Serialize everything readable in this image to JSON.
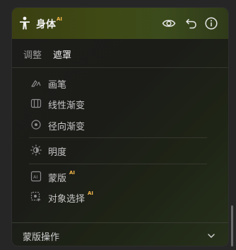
{
  "header": {
    "title": "身体",
    "title_badge": "AI",
    "icons": [
      "person-icon",
      "eye-icon",
      "undo-icon",
      "info-icon"
    ]
  },
  "tabs": [
    {
      "label": "调整",
      "active": false
    },
    {
      "label": "遮罩",
      "active": true
    }
  ],
  "items": [
    {
      "label": "画笔",
      "icon": "brush-icon"
    },
    {
      "label": "线性渐变",
      "icon": "linear-gradient-icon"
    },
    {
      "label": "径向渐变",
      "icon": "radial-gradient-icon"
    },
    {
      "label": "明度",
      "icon": "brightness-icon"
    },
    {
      "label": "蒙版",
      "badge": "AI",
      "icon": "ai-mask-icon"
    },
    {
      "label": "对象选择",
      "badge": "AI",
      "icon": "object-select-icon"
    }
  ],
  "footer": {
    "label": "蒙版操作",
    "icon": "chevron-down-icon"
  },
  "colors": {
    "header_gradient_start": "#3b3f12",
    "header_gradient_end": "#2f3a1a",
    "ai_badge": "#f2b64a",
    "text": "#c8c8c8"
  }
}
